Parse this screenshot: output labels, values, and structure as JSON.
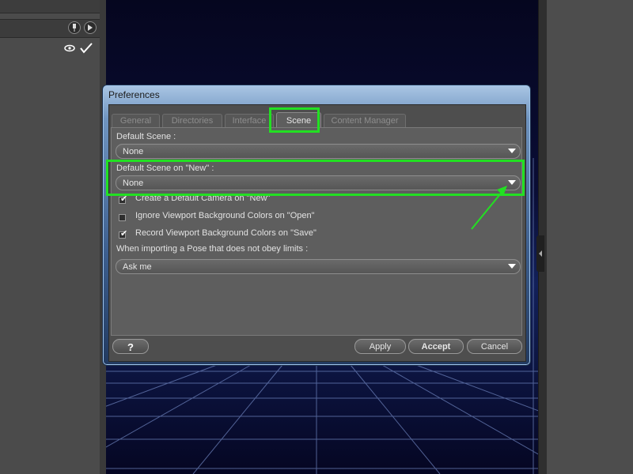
{
  "dialog": {
    "title": "Preferences",
    "tabs": [
      {
        "label": "General",
        "active": false
      },
      {
        "label": "Directories",
        "active": false
      },
      {
        "label": "Interface",
        "active": false
      },
      {
        "label": "Scene",
        "active": true
      },
      {
        "label": "Content Manager",
        "active": false
      }
    ],
    "scene": {
      "default_scene_label": "Default Scene :",
      "default_scene_value": "None",
      "default_scene_new_label": "Default Scene on \"New\" :",
      "default_scene_new_value": "None",
      "checkboxes": [
        {
          "label": "Create a Default Camera on \"New\"",
          "checked": true
        },
        {
          "label": "Ignore Viewport Background Colors on \"Open\"",
          "checked": false
        },
        {
          "label": "Record Viewport Background Colors on \"Save\"",
          "checked": true
        }
      ],
      "pose_limits_label": "When importing a Pose that does not obey limits :",
      "pose_limits_value": "Ask me"
    },
    "buttons": {
      "help_icon": "help-question-icon",
      "apply": "Apply",
      "accept": "Accept",
      "cancel": "Cancel"
    }
  },
  "background": {
    "viewport_color": "#05061f",
    "highlight_color": "#22e022"
  },
  "icons": [
    "pin-icon",
    "play-arrow-icon",
    "eye-icon",
    "checkmark-icon",
    "dropdown-arrow-icon",
    "help-icon"
  ]
}
